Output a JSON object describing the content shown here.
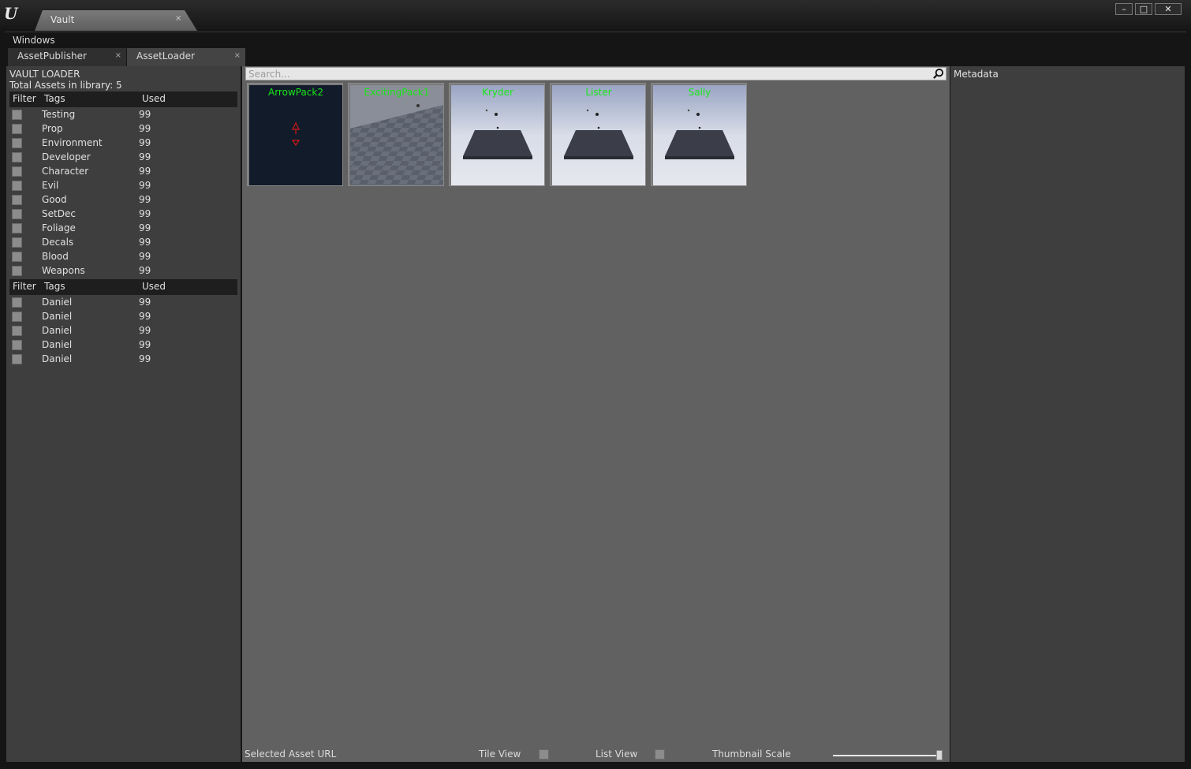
{
  "window": {
    "tab_title": "Vault",
    "tab_close": "×",
    "controls": {
      "minimize": "–",
      "maximize": "□",
      "close": "✕"
    }
  },
  "menu": {
    "windows": "Windows"
  },
  "panel_tabs": [
    {
      "label": "AssetPublisher",
      "close": "×"
    },
    {
      "label": "AssetLoader",
      "close": "×"
    }
  ],
  "left": {
    "title": "VAULT LOADER",
    "total": "Total Assets in library: 5",
    "tags_header": {
      "filter": "Filter",
      "tags": "Tags",
      "used": "Used"
    },
    "tags": [
      {
        "name": "Testing",
        "used": "99"
      },
      {
        "name": "Prop",
        "used": "99"
      },
      {
        "name": "Environment",
        "used": "99"
      },
      {
        "name": "Developer",
        "used": "99"
      },
      {
        "name": "Character",
        "used": "99"
      },
      {
        "name": "Evil",
        "used": "99"
      },
      {
        "name": "Good",
        "used": "99"
      },
      {
        "name": "SetDec",
        "used": "99"
      },
      {
        "name": "Foliage",
        "used": "99"
      },
      {
        "name": "Decals",
        "used": "99"
      },
      {
        "name": "Blood",
        "used": "99"
      },
      {
        "name": "Weapons",
        "used": "99"
      }
    ],
    "authors_header": {
      "filter": "Filter",
      "tags": "Tags",
      "used": "Used"
    },
    "authors": [
      {
        "name": "Daniel",
        "used": "99"
      },
      {
        "name": "Daniel",
        "used": "99"
      },
      {
        "name": "Daniel",
        "used": "99"
      },
      {
        "name": "Daniel",
        "used": "99"
      },
      {
        "name": "Daniel",
        "used": "99"
      }
    ]
  },
  "center": {
    "search_placeholder": "Search...",
    "assets": [
      {
        "name": "ArrowPack2",
        "thumb": "dark"
      },
      {
        "name": "ExcitingPack1",
        "thumb": "checker"
      },
      {
        "name": "Kryder",
        "thumb": "sky"
      },
      {
        "name": "Lister",
        "thumb": "sky"
      },
      {
        "name": "Sally",
        "thumb": "sky"
      }
    ],
    "label_color": "#19e619",
    "bottom": {
      "selected_url": "Selected Asset URL",
      "tile_view": "Tile View",
      "list_view": "List View",
      "thumbnail_scale": "Thumbnail Scale",
      "scale_value": 1.0
    }
  },
  "right": {
    "metadata": "Metadata"
  }
}
